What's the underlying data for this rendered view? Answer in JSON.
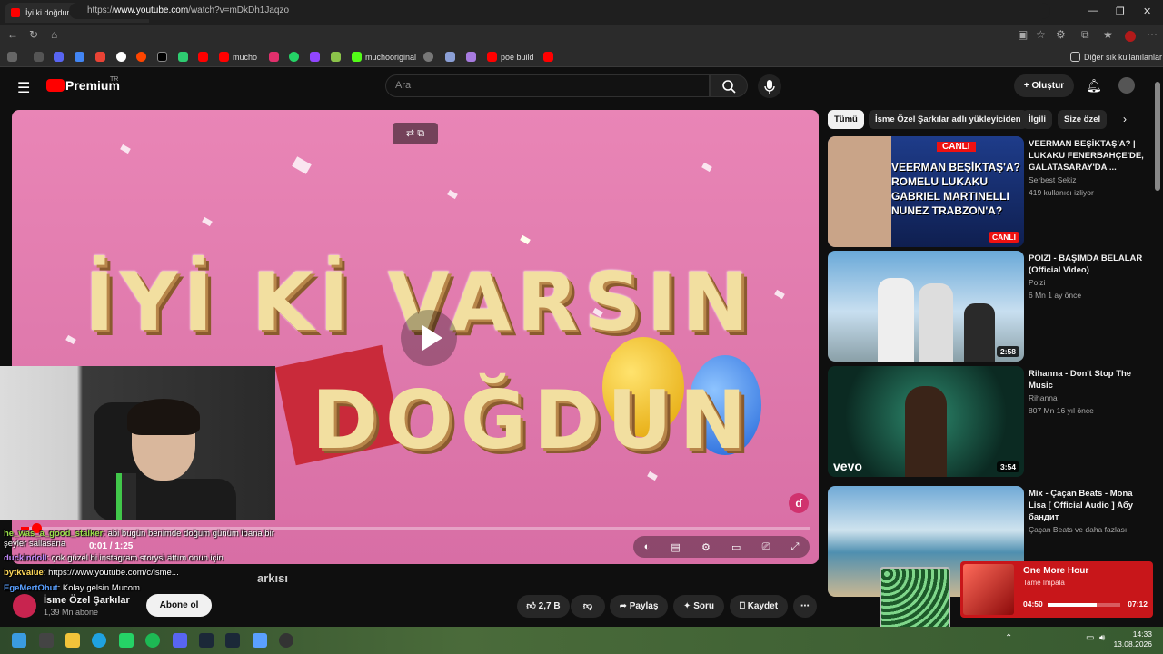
{
  "browser": {
    "tab_title": "İyi ki doğdun EMİN - İsme Özel Da",
    "tab_close": "✕",
    "new_tab": "+",
    "url_prefix": "https://",
    "url_host": "www.youtube.com",
    "url_path": "/watch?v=mDkDh1Jaqzo",
    "bookmarks": [
      "mucho",
      "muchooriginal",
      "poe build"
    ],
    "other_bookmarks": "Diğer sık kullanılanlar",
    "colors": {
      "tab_favicon": "#ff0000",
      "toolbar_bg": "#2b2b2b"
    }
  },
  "youtube": {
    "logo_text": "Premium",
    "logo_region": "TR",
    "search_placeholder": "Ara",
    "create_label": "Oluştur",
    "icons": [
      "menu-icon",
      "search-icon",
      "mic-icon",
      "bell-icon",
      "avatar"
    ]
  },
  "player": {
    "video_line1": "İYİ Kİ VARSIN",
    "video_line2": "DOĞDUN",
    "time": "0:01 / 1:25",
    "progress_fraction": 0.01,
    "badge": "ɗ"
  },
  "video": {
    "title_partial": "arkısı",
    "channel_name": "İsme Özel Şarkılar",
    "subscribers": "1,39 Mn abone",
    "subscribe_label": "Abone ol",
    "likes": "2,7 B",
    "share_label": "Paylaş",
    "ask_label": "Soru",
    "save_label": "Kaydet"
  },
  "chat": [
    {
      "user": "he_was_a_good_stalker",
      "message": ": abi bugün benimde doğum günüm ibana bir şeyler sallasana",
      "color": "#9ae04a"
    },
    {
      "user": "duckindoll",
      "message": ": çok güzel bi instagram storysi attım onun için",
      "color": "#c68cff"
    },
    {
      "user": "bytkvalue",
      "message": ": https://www.youtube.com/c/isme...",
      "color": "#5aa0ff"
    },
    {
      "user": "EgeMertOhut",
      "message": ": Kolay gelsin Mucom",
      "color": "#5aa0ff"
    }
  ],
  "sidebar": {
    "chips": [
      "Tümü",
      "İsme Özel Şarkılar adlı yükleyiciden",
      "İlgili",
      "Size özel"
    ],
    "videos": [
      {
        "title": "VEERMAN BEŞİKTAŞ'A? | LUKAKU FENERBAHÇE'DE, GALATASARAY'DA ...",
        "channel": "Serbest Sekiz",
        "meta": "419 kullanıcı izliyor",
        "thumb_text": "VEERMAN BEŞİKTAŞ'A? ROMELU LUKAKU GABRIEL MARTINELLI NUNEZ TRABZON'A?",
        "badge": "CANLI",
        "live": "CANLI"
      },
      {
        "title": "POIZI - BAŞIMDA BELALAR (Official Video)",
        "channel": "Poizi",
        "meta": "6 Mn  1 ay önce",
        "duration": "2:58"
      },
      {
        "title": "Rihanna - Don't Stop The Music",
        "channel": "Rihanna",
        "meta": "807 Mn  16 yıl önce",
        "duration": "3:54",
        "thumb_logo": "vevo"
      },
      {
        "title": "Mix - Çaçan Beats - Mona Lisa [ Official Audio ] Абу бандит",
        "channel": "Çaçan Beats ve daha fazlası",
        "meta": ""
      }
    ]
  },
  "spotify": {
    "track": "One More Hour",
    "artist": "Tame Impala",
    "elapsed": "04:50",
    "total": "07:12",
    "progress_fraction": 0.67
  },
  "taskbar": {
    "time": "14:33",
    "date": "13.08.2026"
  }
}
